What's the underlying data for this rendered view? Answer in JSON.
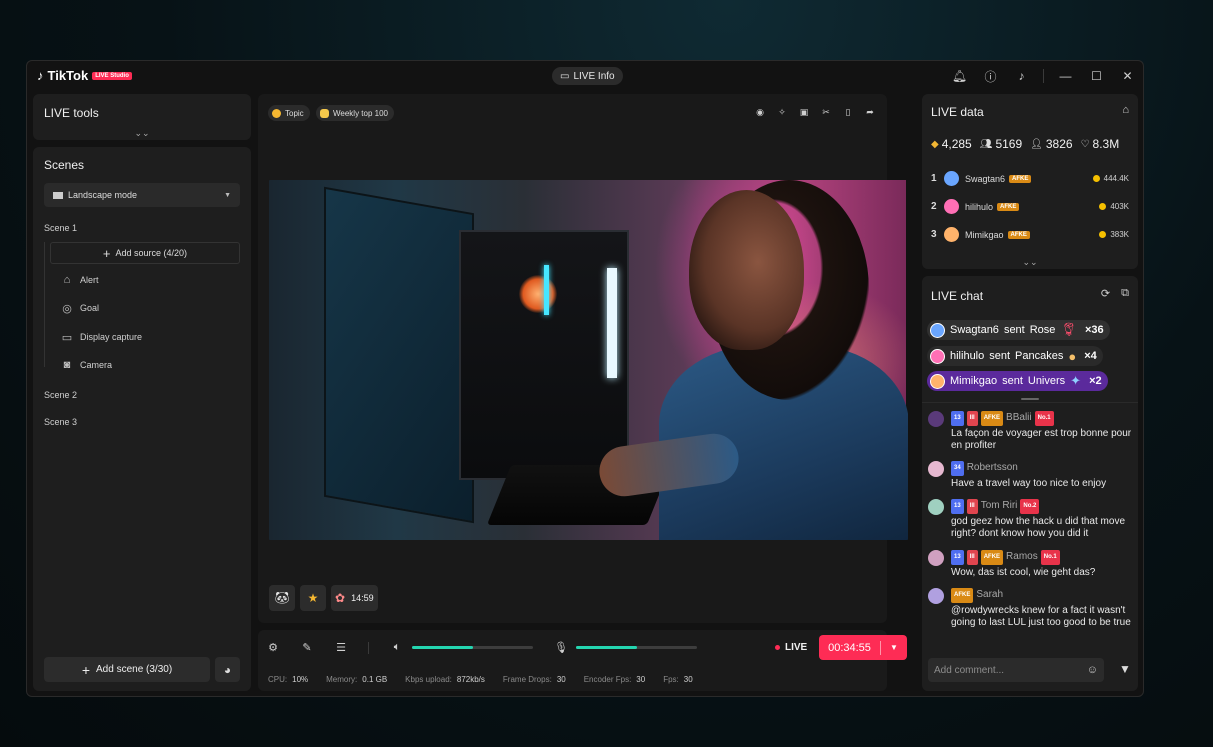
{
  "app": {
    "logo_name": "TikTok",
    "logo_badge": "LIVE Studio",
    "live_info_label": "LIVE Info"
  },
  "left": {
    "live_tools_title": "LIVE tools",
    "scenes_title": "Scenes",
    "mode_select_value": "Landscape mode",
    "scene1": "Scene 1",
    "add_source_label": "Add source (4/20)",
    "sources": [
      "Alert",
      "Goal",
      "Display capture",
      "Camera"
    ],
    "scene2": "Scene 2",
    "scene3": "Scene 3",
    "add_scene_label": "Add scene (3/30)"
  },
  "stage": {
    "chip_topic": "Topic",
    "chip_weekly": "Weekly top 100",
    "gift_timer": "14:59"
  },
  "controls": {
    "volume_level": 0.5,
    "mic_level": 0.5,
    "live_label": "LIVE",
    "live_timer": "00:34:55",
    "stats": [
      {
        "label": "CPU:",
        "value": "10%"
      },
      {
        "label": "Memory:",
        "value": "0.1 GB"
      },
      {
        "label": "Kbps upload:",
        "value": "872kb/s"
      },
      {
        "label": "Frame Drops:",
        "value": "30"
      },
      {
        "label": "Encoder Fps:",
        "value": "30"
      },
      {
        "label": "Fps:",
        "value": "30"
      }
    ]
  },
  "live_data": {
    "title": "LIVE data",
    "metrics": {
      "gems": "4,285",
      "viewers": "5169",
      "new_followers": "3826",
      "likes": "8.3M"
    },
    "ranking": [
      {
        "rank": "1",
        "name": "Swagtan6",
        "badge": "AFKE",
        "score": "444.4K",
        "color": "#6aa6ff"
      },
      {
        "rank": "2",
        "name": "hilihulo",
        "badge": "AFKE",
        "score": "403K",
        "color": "#ff6fb5"
      },
      {
        "rank": "3",
        "name": "Mimikgao",
        "badge": "AFKE",
        "score": "383K",
        "color": "#ffb36b"
      }
    ]
  },
  "live_chat": {
    "title": "LIVE chat",
    "gifts": [
      {
        "user": "Swagtan6",
        "verb": "sent",
        "gift": "Rose",
        "count": "×36",
        "bg": "#303030",
        "color": "#6aa6ff"
      },
      {
        "user": "hilihulo",
        "verb": "sent",
        "gift": "Pancakes",
        "count": "×4",
        "bg": "#2a2a2a",
        "color": "#ff6fb5"
      },
      {
        "user": "Mimikgao",
        "verb": "sent",
        "gift": "Univers",
        "count": "×2",
        "bg": "#5b2a9c",
        "color": "#ffb36b"
      }
    ],
    "messages": [
      {
        "name": "BBalii",
        "lvl": "13",
        "fan": "III",
        "afke": "AFKE",
        "no": "No.1",
        "text": "La façon de voyager est trop bonne pour en profiter",
        "color": "#5a3a7a"
      },
      {
        "name": "Robertsson",
        "lvl": "34",
        "text": "Have a travel way too nice to enjoy",
        "color": "#e6b8d0"
      },
      {
        "name": "Tom Riri",
        "lvl": "13",
        "fan": "III",
        "no": "No.2",
        "text": "god geez how the hack u did that move right? dont know how you did it",
        "color": "#9fd0c0"
      },
      {
        "name": "Ramos",
        "lvl": "13",
        "fan": "III",
        "afke": "AFKE",
        "no": "No.1",
        "text": "Wow, das ist cool, wie geht das?",
        "color": "#d0a0c0"
      },
      {
        "name": "Sarah",
        "afke": "AFKE",
        "text": "@rowdywrecks knew for a fact it wasn't going to last LUL just too good to be true",
        "color": "#b0a0e0"
      }
    ],
    "comment_placeholder": "Add comment..."
  }
}
